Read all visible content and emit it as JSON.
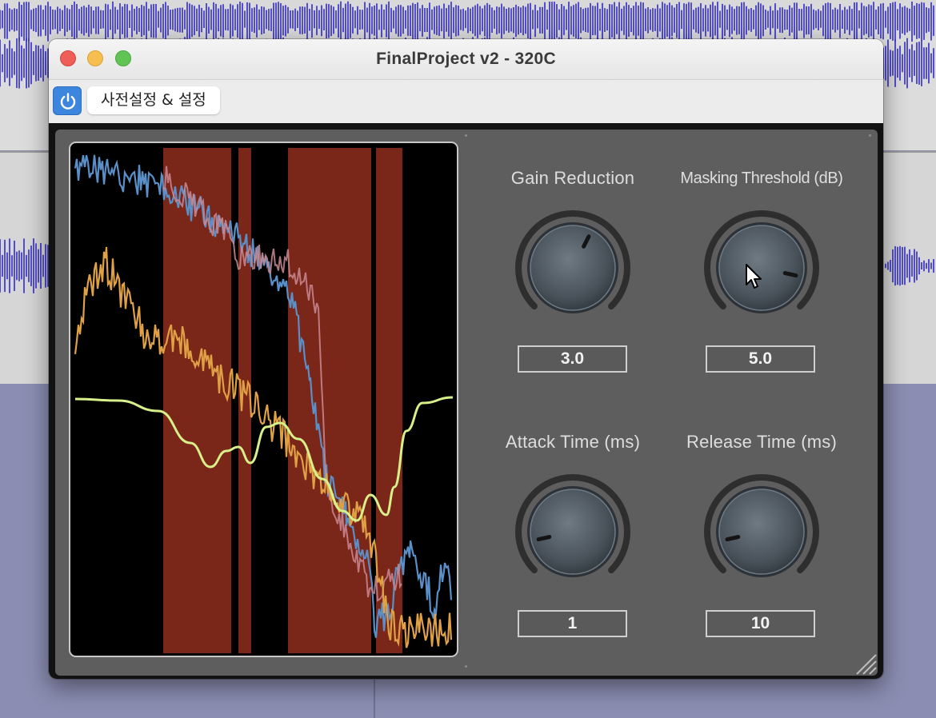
{
  "window": {
    "title": "FinalProject v2 - 320C"
  },
  "toolbar": {
    "power_icon": "power-icon",
    "preset_label": "사전설정 & 설정"
  },
  "colors": {
    "background_waveform": "#3b35c8",
    "spectrum_blue": "#5a8fc8",
    "spectrum_orange": "#e0a045",
    "threshold_curve": "#d8f08a",
    "band_red": "#7a2619",
    "knob_panel": "#5e5e5e"
  },
  "controls": {
    "gain_reduction": {
      "label": "Gain Reduction",
      "value": "3.0",
      "level": 0.6
    },
    "masking_threshold": {
      "label": "Masking Threshold (dB)",
      "value": "5.0",
      "level": 0.88
    },
    "attack_time": {
      "label": "Attack Time (ms)",
      "value": "1",
      "level": 0.12
    },
    "release_time": {
      "label": "Release Time (ms)",
      "value": "10",
      "level": 0.12
    }
  }
}
